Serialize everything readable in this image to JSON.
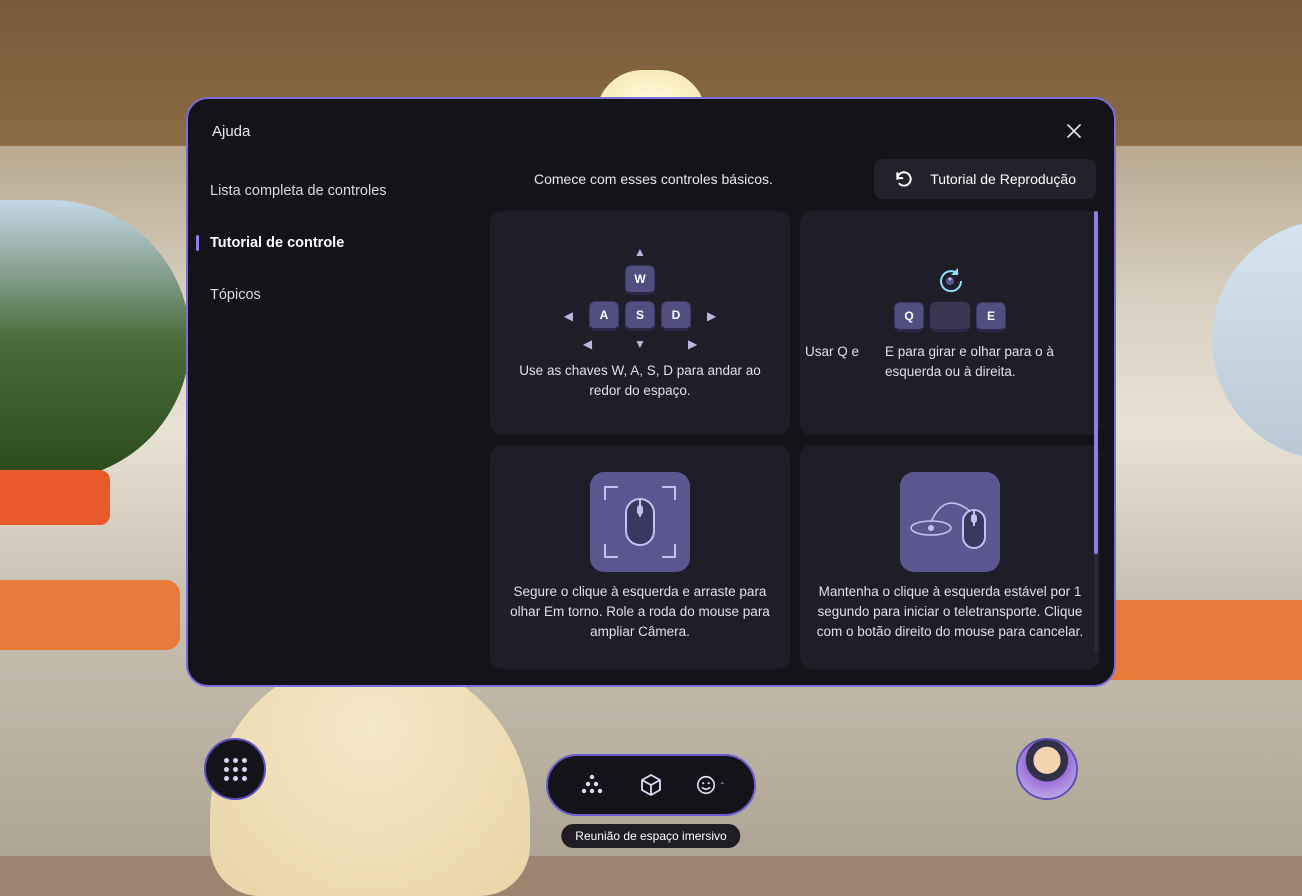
{
  "modal": {
    "title": "Ajuda",
    "intro": "Comece com esses controles básicos.",
    "replay_label": "Tutorial de Reprodução",
    "close_label": "Fechar"
  },
  "sidebar": {
    "items": [
      {
        "label": "Lista completa de controles",
        "active": false
      },
      {
        "label": "Tutorial de controle",
        "active": true
      },
      {
        "label": "Tópicos",
        "active": false
      }
    ]
  },
  "cards": {
    "wasd": {
      "desc": "Use as chaves W, A, S, D para andar ao redor do espaço.",
      "keys": {
        "up": "W",
        "left": "A",
        "down": "S",
        "right": "D"
      }
    },
    "qe": {
      "left": "Usar Q e",
      "right": "E para girar e olhar para o à esquerda ou à direita.",
      "keys": {
        "q": "Q",
        "e": "E"
      }
    },
    "look": {
      "desc": "Segure o clique à esquerda e arraste para olhar Em torno. Role a roda do mouse para ampliar Câmera."
    },
    "teleport": {
      "desc": "Mantenha o clique à esquerda estável por 1 segundo para iniciar o teletransporte. Clique com o botão direito do mouse para cancelar."
    }
  },
  "hud": {
    "grid_label": "Menu",
    "space_label": "Espaço",
    "view_label": "Visão",
    "react_label": "Reagir",
    "avatar_label": "Avatar",
    "caption": "Reunião de espaço imersivo"
  }
}
